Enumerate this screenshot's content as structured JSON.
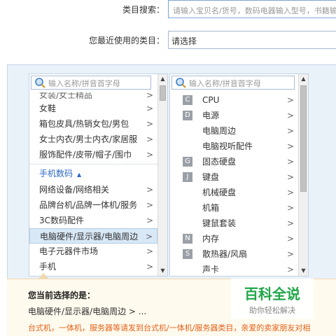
{
  "search": {
    "label": "类目搜索：",
    "placeholder": "请输入宝贝名/货号，数码电器输入型号，书籍输入"
  },
  "recent": {
    "label": "您最近使用的类目：",
    "value": "请选择"
  },
  "column1": {
    "filter_placeholder": "输入名称/拼音首字母",
    "items_top": [
      {
        "label": "女装/女士精品",
        "partial": true
      },
      {
        "label": "女鞋"
      },
      {
        "label": "箱包皮具/热销女包/男包"
      },
      {
        "label": "女士内衣/男士内衣/家居服"
      },
      {
        "label": "服饰配件/皮带/帽子/围巾"
      }
    ],
    "group": "手机数码",
    "items_group": [
      {
        "label": "网络设备/网络相关"
      },
      {
        "label": "品牌台机/品牌一体机/服务"
      },
      {
        "label": "3C数码配件"
      },
      {
        "label": "电脑硬件/显示器/电脑周边",
        "selected": true
      },
      {
        "label": "电子元器件市场"
      },
      {
        "label": "手机"
      }
    ],
    "arrow": ">"
  },
  "column2": {
    "filter_placeholder": "输入名称/拼音首字母",
    "items": [
      {
        "letter": "C",
        "label": "CPU"
      },
      {
        "letter": "D",
        "label": "电源"
      },
      {
        "letter": "",
        "label": "电脑周边"
      },
      {
        "letter": "",
        "label": "电脑视听配件"
      },
      {
        "letter": "G",
        "label": "固态硬盘"
      },
      {
        "letter": "J",
        "label": "键盘"
      },
      {
        "letter": "",
        "label": "机械硬盘"
      },
      {
        "letter": "",
        "label": "机箱"
      },
      {
        "letter": "",
        "label": "键鼠套装"
      },
      {
        "letter": "N",
        "label": "内存"
      },
      {
        "letter": "S",
        "label": "散热器/风扇"
      },
      {
        "letter": "",
        "label": "声卡"
      }
    ],
    "arrow": ">"
  },
  "footer": {
    "title": "您当前选择的是：",
    "path": "电脑硬件/显示器/电脑周边 > ...",
    "warning": "台式机，一体机，服务器等请发到台式机/一体机/服务器类目，亲爱的卖家朋友对相"
  },
  "watermark": {
    "main": "百科全说",
    "sub": "助你轻松解决"
  },
  "colors": {
    "accent": "#2a67c2",
    "warning": "#e2621a",
    "selected_bg": "#d8e8f7",
    "watermark_green": "#1fa64a"
  }
}
